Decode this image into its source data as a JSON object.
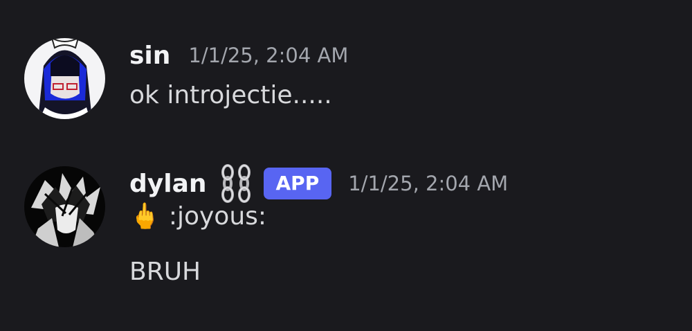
{
  "messages": [
    {
      "username": "sin",
      "timestamp": "1/1/25, 2:04 AM",
      "avatar": "avatar-sin",
      "lines": [
        "ok introjectie....."
      ]
    },
    {
      "username": "dylan",
      "username_icon": "chain-icon",
      "badge": "APP",
      "timestamp": "1/1/25, 2:04 AM",
      "avatar": "avatar-dylan",
      "lines": [
        {
          "emoji": "🖕",
          "text": ":joyous:"
        },
        "BRUH"
      ]
    }
  ],
  "colors": {
    "background": "#1a1a1e",
    "username": "#f2f3f5",
    "timestamp": "#a3a6ad",
    "badge": "#5865f2",
    "text": "#d8d9dc"
  }
}
